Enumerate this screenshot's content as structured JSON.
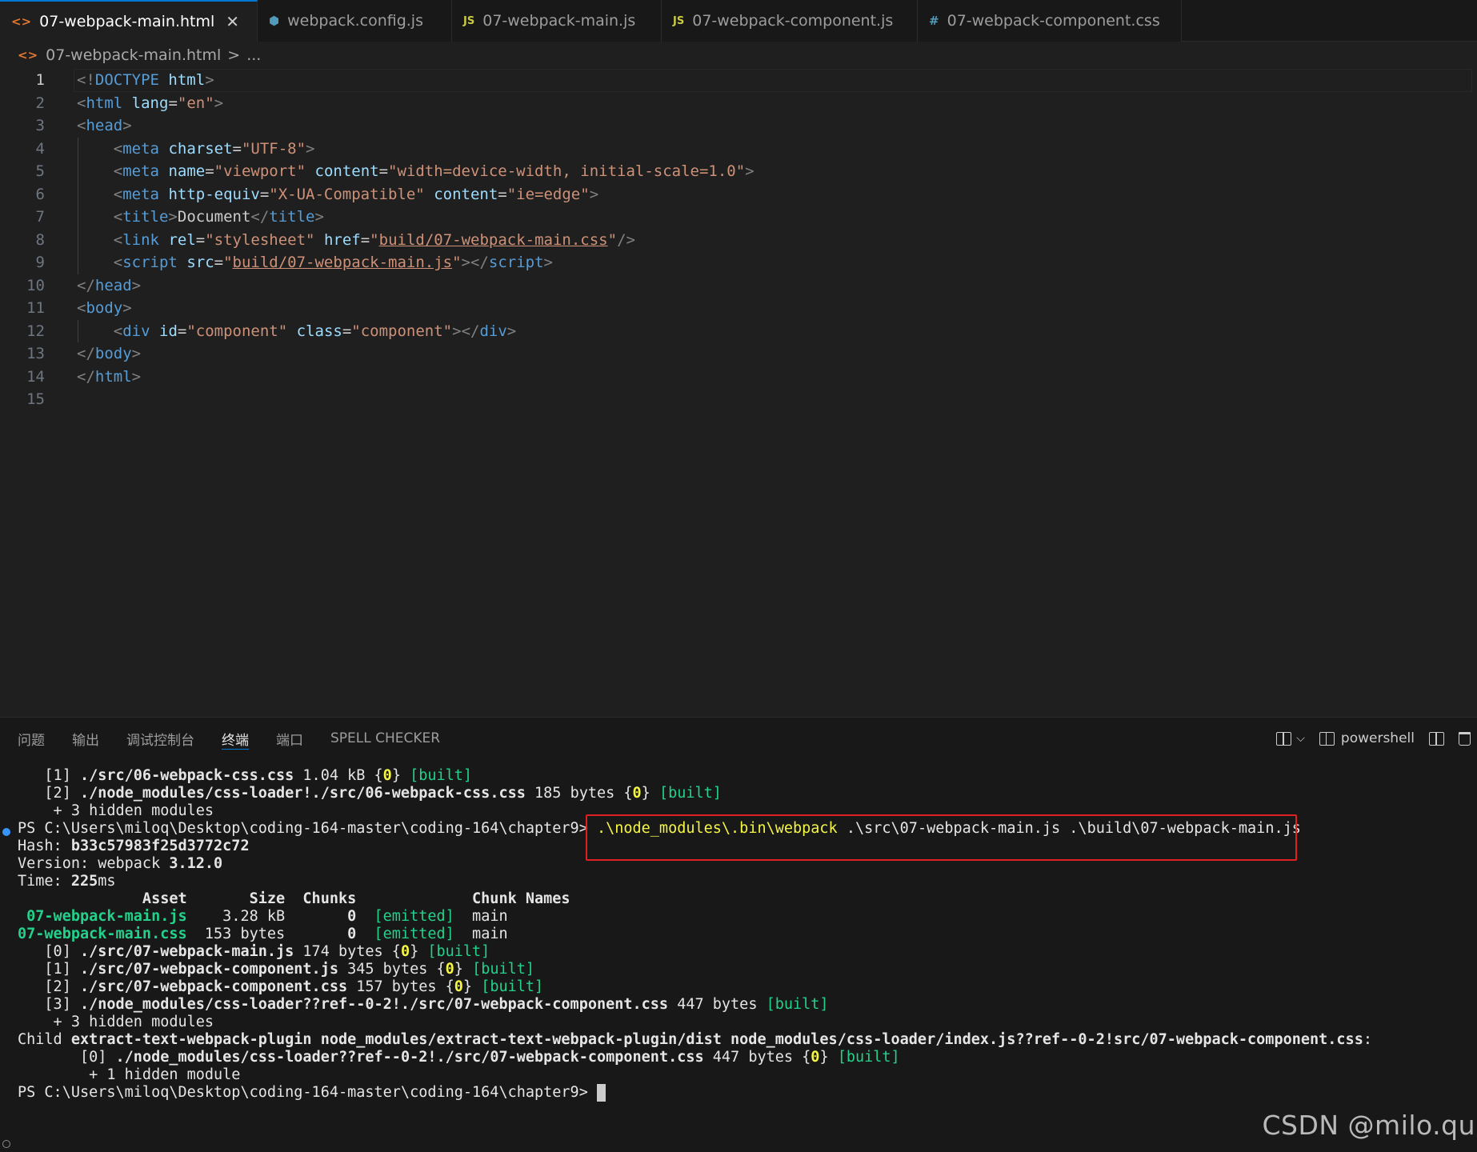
{
  "tabs": [
    {
      "icon": "<>",
      "label": "07-webpack-main.html",
      "close": "✕",
      "active": true
    },
    {
      "icon": "⬢",
      "label": "webpack.config.js"
    },
    {
      "icon": "JS",
      "label": "07-webpack-main.js"
    },
    {
      "icon": "JS",
      "label": "07-webpack-component.js"
    },
    {
      "icon": "#",
      "label": "07-webpack-component.css"
    }
  ],
  "breadcrumb": {
    "icon": "<>",
    "file": "07-webpack-main.html",
    "sep": ">",
    "rest": "..."
  },
  "editor": {
    "line_numbers": [
      "1",
      "2",
      "3",
      "4",
      "5",
      "6",
      "7",
      "8",
      "9",
      "10",
      "11",
      "12",
      "13",
      "14",
      "15"
    ],
    "lines": [
      [
        [
          "br",
          "<!"
        ],
        [
          "tag",
          "DOCTYPE"
        ],
        [
          "txt",
          " "
        ],
        [
          "attr",
          "html"
        ],
        [
          "br",
          ">"
        ]
      ],
      [
        [
          "br",
          "<"
        ],
        [
          "tag",
          "html"
        ],
        [
          "txt",
          " "
        ],
        [
          "attr",
          "lang"
        ],
        [
          "txt",
          "="
        ],
        [
          "str",
          "\"en\""
        ],
        [
          "br",
          ">"
        ]
      ],
      [
        [
          "br",
          "<"
        ],
        [
          "tag",
          "head"
        ],
        [
          "br",
          ">"
        ]
      ],
      [
        [
          "txt",
          "    "
        ],
        [
          "br",
          "<"
        ],
        [
          "tag",
          "meta"
        ],
        [
          "txt",
          " "
        ],
        [
          "attr",
          "charset"
        ],
        [
          "txt",
          "="
        ],
        [
          "str",
          "\"UTF-8\""
        ],
        [
          "br",
          ">"
        ]
      ],
      [
        [
          "txt",
          "    "
        ],
        [
          "br",
          "<"
        ],
        [
          "tag",
          "meta"
        ],
        [
          "txt",
          " "
        ],
        [
          "attr",
          "name"
        ],
        [
          "txt",
          "="
        ],
        [
          "str",
          "\"viewport\""
        ],
        [
          "txt",
          " "
        ],
        [
          "attr",
          "content"
        ],
        [
          "txt",
          "="
        ],
        [
          "str",
          "\"width=device-width, initial-scale=1.0\""
        ],
        [
          "br",
          ">"
        ]
      ],
      [
        [
          "txt",
          "    "
        ],
        [
          "br",
          "<"
        ],
        [
          "tag",
          "meta"
        ],
        [
          "txt",
          " "
        ],
        [
          "attr",
          "http-equiv"
        ],
        [
          "txt",
          "="
        ],
        [
          "str",
          "\"X-UA-Compatible\""
        ],
        [
          "txt",
          " "
        ],
        [
          "attr",
          "content"
        ],
        [
          "txt",
          "="
        ],
        [
          "str",
          "\"ie=edge\""
        ],
        [
          "br",
          ">"
        ]
      ],
      [
        [
          "txt",
          "    "
        ],
        [
          "br",
          "<"
        ],
        [
          "tag",
          "title"
        ],
        [
          "br",
          ">"
        ],
        [
          "txt",
          "Document"
        ],
        [
          "br",
          "</"
        ],
        [
          "tag",
          "title"
        ],
        [
          "br",
          ">"
        ]
      ],
      [
        [
          "txt",
          "    "
        ],
        [
          "br",
          "<"
        ],
        [
          "tag",
          "link"
        ],
        [
          "txt",
          " "
        ],
        [
          "attr",
          "rel"
        ],
        [
          "txt",
          "="
        ],
        [
          "str",
          "\"stylesheet\""
        ],
        [
          "txt",
          " "
        ],
        [
          "attr",
          "href"
        ],
        [
          "txt",
          "="
        ],
        [
          "str",
          "\""
        ],
        [
          "link",
          "build/07-webpack-main.css"
        ],
        [
          "str",
          "\""
        ],
        [
          "br",
          "/>"
        ]
      ],
      [
        [
          "txt",
          "    "
        ],
        [
          "br",
          "<"
        ],
        [
          "tag",
          "script"
        ],
        [
          "txt",
          " "
        ],
        [
          "attr",
          "src"
        ],
        [
          "txt",
          "="
        ],
        [
          "str",
          "\""
        ],
        [
          "link",
          "build/07-webpack-main.js"
        ],
        [
          "str",
          "\""
        ],
        [
          "br",
          "></"
        ],
        [
          "tag",
          "script"
        ],
        [
          "br",
          ">"
        ]
      ],
      [
        [
          "br",
          "</"
        ],
        [
          "tag",
          "head"
        ],
        [
          "br",
          ">"
        ]
      ],
      [
        [
          "br",
          "<"
        ],
        [
          "tag",
          "body"
        ],
        [
          "br",
          ">"
        ]
      ],
      [
        [
          "txt",
          "    "
        ],
        [
          "br",
          "<"
        ],
        [
          "tag",
          "div"
        ],
        [
          "txt",
          " "
        ],
        [
          "attr",
          "id"
        ],
        [
          "txt",
          "="
        ],
        [
          "str",
          "\"component\""
        ],
        [
          "txt",
          " "
        ],
        [
          "attr",
          "class"
        ],
        [
          "txt",
          "="
        ],
        [
          "str",
          "\"component\""
        ],
        [
          "br",
          "></"
        ],
        [
          "tag",
          "div"
        ],
        [
          "br",
          ">"
        ]
      ],
      [
        [
          "br",
          "</"
        ],
        [
          "tag",
          "body"
        ],
        [
          "br",
          ">"
        ]
      ],
      [
        [
          "br",
          "</"
        ],
        [
          "tag",
          "html"
        ],
        [
          "br",
          ">"
        ]
      ],
      []
    ]
  },
  "panel": {
    "tabs": [
      "问题",
      "输出",
      "调试控制台",
      "终端",
      "端口",
      "SPELL CHECKER"
    ],
    "active_tab": "终端",
    "shell_label": "powershell",
    "dropdown": "⌵"
  },
  "terminal": {
    "lines": [
      [
        [
          "w",
          "   [1] "
        ],
        [
          "wb",
          "./src/06-webpack-css.css"
        ],
        [
          "w",
          " 1.04 kB {"
        ],
        [
          "yb",
          "0"
        ],
        [
          "w",
          "} "
        ],
        [
          "g",
          "[built]"
        ]
      ],
      [
        [
          "w",
          "   [2] "
        ],
        [
          "wb",
          "./node_modules/css-loader!./src/06-webpack-css.css"
        ],
        [
          "w",
          " 185 bytes {"
        ],
        [
          "yb",
          "0"
        ],
        [
          "w",
          "} "
        ],
        [
          "g",
          "[built]"
        ]
      ],
      [
        [
          "w",
          "    + 3 hidden modules"
        ]
      ],
      [
        [
          "w",
          "PS C:\\Users\\miloq\\Desktop\\coding-164-master\\coding-164\\chapter9> "
        ],
        [
          "y",
          ".\\node_modules\\.bin\\webpack"
        ],
        [
          "w",
          " .\\src\\07-webpack-main.js .\\build\\07-webpack-main.js"
        ]
      ],
      [
        [
          "w",
          "Hash: "
        ],
        [
          "wb",
          "b33c57983f25d3772c72"
        ]
      ],
      [
        [
          "w",
          "Version: webpack "
        ],
        [
          "wb",
          "3.12.0"
        ]
      ],
      [
        [
          "w",
          "Time: "
        ],
        [
          "wb",
          "225"
        ],
        [
          "w",
          "ms"
        ]
      ],
      [
        [
          "wb",
          "              Asset       Size  Chunks             Chunk Names"
        ]
      ],
      [
        [
          "gb",
          " 07-webpack-main.js"
        ],
        [
          "w",
          "    3.28 kB       "
        ],
        [
          "wb",
          "0"
        ],
        [
          "w",
          "  "
        ],
        [
          "g",
          "[emitted]"
        ],
        [
          "w",
          "  main"
        ]
      ],
      [
        [
          "gb",
          "07-webpack-main.css"
        ],
        [
          "w",
          "  153 bytes       "
        ],
        [
          "wb",
          "0"
        ],
        [
          "w",
          "  "
        ],
        [
          "g",
          "[emitted]"
        ],
        [
          "w",
          "  main"
        ]
      ],
      [
        [
          "w",
          "   [0] "
        ],
        [
          "wb",
          "./src/07-webpack-main.js"
        ],
        [
          "w",
          " 174 bytes {"
        ],
        [
          "yb",
          "0"
        ],
        [
          "w",
          "} "
        ],
        [
          "g",
          "[built]"
        ]
      ],
      [
        [
          "w",
          "   [1] "
        ],
        [
          "wb",
          "./src/07-webpack-component.js"
        ],
        [
          "w",
          " 345 bytes {"
        ],
        [
          "yb",
          "0"
        ],
        [
          "w",
          "} "
        ],
        [
          "g",
          "[built]"
        ]
      ],
      [
        [
          "w",
          "   [2] "
        ],
        [
          "wb",
          "./src/07-webpack-component.css"
        ],
        [
          "w",
          " 157 bytes {"
        ],
        [
          "yb",
          "0"
        ],
        [
          "w",
          "} "
        ],
        [
          "g",
          "[built]"
        ]
      ],
      [
        [
          "w",
          "   [3] "
        ],
        [
          "wb",
          "./node_modules/css-loader??ref--0-2!./src/07-webpack-component.css"
        ],
        [
          "w",
          " 447 bytes "
        ],
        [
          "g",
          "[built]"
        ]
      ],
      [
        [
          "w",
          "    + 3 hidden modules"
        ]
      ],
      [
        [
          "w",
          "Child "
        ],
        [
          "wb",
          "extract-text-webpack-plugin node_modules/extract-text-webpack-plugin/dist node_modules/css-loader/index.js??ref--0-2!src/07-webpack-component.css"
        ],
        [
          "w",
          ":"
        ]
      ],
      [
        [
          "w",
          "       [0] "
        ],
        [
          "wb",
          "./node_modules/css-loader??ref--0-2!./src/07-webpack-component.css"
        ],
        [
          "w",
          " 447 bytes {"
        ],
        [
          "yb",
          "0"
        ],
        [
          "w",
          "} "
        ],
        [
          "g",
          "[built]"
        ]
      ],
      [
        [
          "w",
          "        + 1 hidden module"
        ]
      ],
      [
        [
          "w",
          "PS C:\\Users\\miloq\\Desktop\\coding-164-master\\coding-164\\chapter9> "
        ]
      ]
    ]
  },
  "watermark": "CSDN @milo.qu",
  "colors": {
    "accent": "#0078d4",
    "highlight_box": "#e02020",
    "term_green": "#23d18b",
    "term_yellow": "#f5f543"
  }
}
